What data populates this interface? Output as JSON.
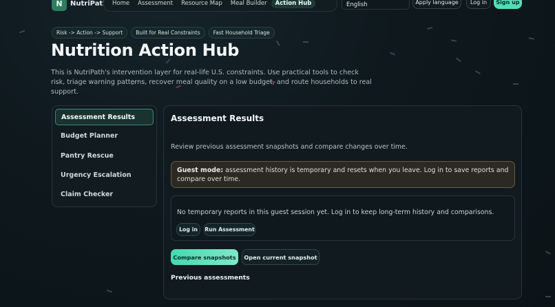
{
  "brand": {
    "logo_letter": "N",
    "name": "NutriPath"
  },
  "nav": {
    "items": [
      {
        "label": "Home"
      },
      {
        "label": "Assessment"
      },
      {
        "label": "Resource Map"
      },
      {
        "label": "Meal Builder"
      },
      {
        "label": "Action Hub",
        "active": true
      }
    ]
  },
  "language": {
    "selected": "English"
  },
  "header_buttons": {
    "apply_language": "Apply language",
    "log_in": "Log in",
    "sign_up": "Sign up"
  },
  "hero": {
    "chips": [
      "Risk -> Action -> Support",
      "Built for Real Constraints",
      "Fast Household Triage"
    ],
    "title": "Nutrition Action Hub",
    "description": "This is NutriPath's intervention layer for real-life U.S. constraints. Use practical tools to check risk, triage warning patterns, recover meal quality on a low budget, and route households to real support."
  },
  "sidebar": {
    "items": [
      {
        "label": "Assessment Results",
        "active": true
      },
      {
        "label": "Budget Planner"
      },
      {
        "label": "Pantry Rescue"
      },
      {
        "label": "Urgency Escalation"
      },
      {
        "label": "Claim Checker"
      }
    ]
  },
  "panel": {
    "title": "Assessment Results",
    "description": "Review previous assessment snapshots and compare changes over time.",
    "guest_label": "Guest mode:",
    "guest_text": "assessment history is temporary and resets when you leave. Log in to save reports and compare over time.",
    "reports_empty": "No temporary reports in this guest session yet. Log in to keep long-term history and comparisons.",
    "reports_login": "Log in",
    "reports_run": "Run Assessment",
    "compare_button": "Compare snapshots",
    "open_button": "Open current snapshot",
    "previous_title": "Previous assessments"
  },
  "colors": {
    "accent": "#4fe0b6",
    "background": "#0e181d",
    "warning_border": "#6a5a3c"
  }
}
